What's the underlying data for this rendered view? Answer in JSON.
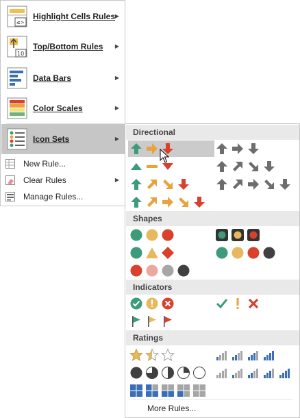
{
  "menu": {
    "items": [
      {
        "label": "Highlight Cells Rules",
        "icon": "highlight-cells-icon"
      },
      {
        "label": "Top/Bottom Rules",
        "icon": "top-bottom-icon"
      },
      {
        "label": "Data Bars",
        "icon": "data-bars-icon"
      },
      {
        "label": "Color Scales",
        "icon": "color-scales-icon"
      },
      {
        "label": "Icon Sets",
        "icon": "icon-sets-icon"
      }
    ],
    "small_items": [
      {
        "label": "New Rule...",
        "icon": "new-rule-icon"
      },
      {
        "label": "Clear Rules",
        "icon": "clear-rules-icon"
      },
      {
        "label": "Manage Rules...",
        "icon": "manage-rules-icon"
      }
    ]
  },
  "submenu": {
    "sections": [
      "Directional",
      "Shapes",
      "Indicators",
      "Ratings"
    ],
    "more_rules": "More Rules..."
  },
  "colors": {
    "green": "#3d9b7a",
    "yellow": "#e8a33d",
    "red": "#d9412b",
    "gray": "#6d6d6d",
    "highlight": "#c6c6c6"
  }
}
